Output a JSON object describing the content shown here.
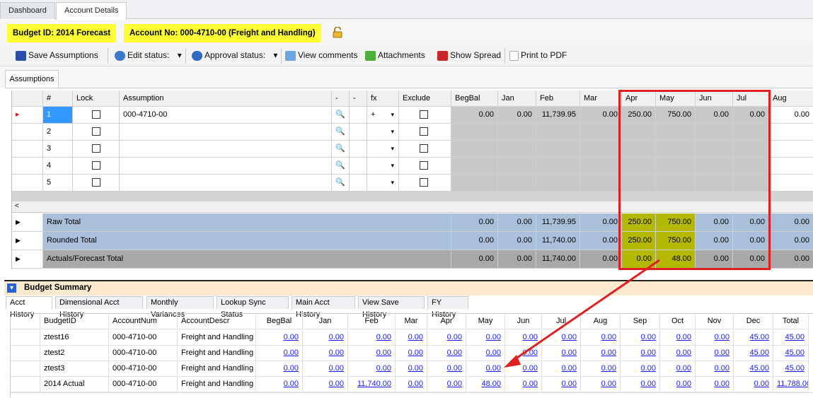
{
  "tabs": [
    {
      "label": "Dashboard"
    },
    {
      "label": "Account Details"
    }
  ],
  "info": {
    "budget": "Budget ID: 2014 Forecast",
    "account": "Account No: 000-4710-00 (Freight and Handling)"
  },
  "toolbar": {
    "save": "Save Assumptions",
    "edit": "Edit status:",
    "approval": "Approval status:",
    "comments": "View comments",
    "attach": "Attachments",
    "spread": "Show Spread",
    "pdf": "Print to PDF"
  },
  "subtab": "Assumptions",
  "grid": {
    "headers": [
      "#",
      "Lock",
      "Assumption",
      "-",
      "-",
      "fx",
      "Exclude",
      "BegBal",
      "Jan",
      "Feb",
      "Mar",
      "Apr",
      "May",
      "Jun",
      "Jul",
      "Aug"
    ],
    "rows": [
      {
        "n": "1",
        "assumption": "000-4710-00",
        "fx": "+",
        "vals": [
          "0.00",
          "0.00",
          "11,739.95",
          "0.00",
          "250.00",
          "750.00",
          "0.00",
          "0.00",
          "0.00"
        ]
      },
      {
        "n": "2",
        "assumption": "",
        "fx": "",
        "vals": [
          "",
          "",
          "",
          "",
          "",
          "",
          "",
          "",
          ""
        ]
      },
      {
        "n": "3",
        "assumption": "",
        "fx": "",
        "vals": [
          "",
          "",
          "",
          "",
          "",
          "",
          "",
          "",
          ""
        ]
      },
      {
        "n": "4",
        "assumption": "",
        "fx": "",
        "vals": [
          "",
          "",
          "",
          "",
          "",
          "",
          "",
          "",
          ""
        ]
      },
      {
        "n": "5",
        "assumption": "",
        "fx": "",
        "vals": [
          "",
          "",
          "",
          "",
          "",
          "",
          "",
          "",
          ""
        ]
      }
    ],
    "totals": [
      {
        "label": "Raw Total",
        "vals": [
          "0.00",
          "0.00",
          "11,739.95",
          "0.00",
          "250.00",
          "750.00",
          "0.00",
          "0.00",
          "0.00"
        ]
      },
      {
        "label": "Rounded Total",
        "vals": [
          "0.00",
          "0.00",
          "11,740.00",
          "0.00",
          "250.00",
          "750.00",
          "0.00",
          "0.00",
          "0.00"
        ]
      },
      {
        "label": "Actuals/Forecast Total",
        "vals": [
          "0.00",
          "0.00",
          "11,740.00",
          "0.00",
          "0.00",
          "48.00",
          "0.00",
          "0.00",
          "0.00"
        ]
      }
    ]
  },
  "summary": {
    "title": "Budget Summary",
    "tabs": [
      "Acct History",
      "Dimensional Acct History",
      "Monthly Variances",
      "Lookup Sync Status",
      "Main Acct History",
      "View Save History",
      "FY History"
    ],
    "headers": [
      "BudgetID",
      "AccountNum",
      "AccountDescr",
      "BegBal",
      "Jan",
      "Feb",
      "Mar",
      "Apr",
      "May",
      "Jun",
      "Jul",
      "Aug",
      "Sep",
      "Oct",
      "Nov",
      "Dec",
      "Total"
    ],
    "rows": [
      [
        "ztest16",
        "000-4710-00",
        "Freight and Handling",
        "0.00",
        "0.00",
        "0.00",
        "0.00",
        "0.00",
        "0.00",
        "0.00",
        "0.00",
        "0.00",
        "0.00",
        "0.00",
        "0.00",
        "45.00",
        "45.00"
      ],
      [
        "ztest2",
        "000-4710-00",
        "Freight and Handling",
        "0.00",
        "0.00",
        "0.00",
        "0.00",
        "0.00",
        "0.00",
        "0.00",
        "0.00",
        "0.00",
        "0.00",
        "0.00",
        "0.00",
        "45.00",
        "45.00"
      ],
      [
        "ztest3",
        "000-4710-00",
        "Freight and Handling",
        "0.00",
        "0.00",
        "0.00",
        "0.00",
        "0.00",
        "0.00",
        "0.00",
        "0.00",
        "0.00",
        "0.00",
        "0.00",
        "0.00",
        "45.00",
        "45.00"
      ],
      [
        "2014 Actual",
        "000-4710-00",
        "Freight and Handling",
        "0.00",
        "0.00",
        "11,740.00",
        "0.00",
        "0.00",
        "48.00",
        "0.00",
        "0.00",
        "0.00",
        "0.00",
        "0.00",
        "0.00",
        "0.00",
        "11,788.00"
      ]
    ]
  }
}
